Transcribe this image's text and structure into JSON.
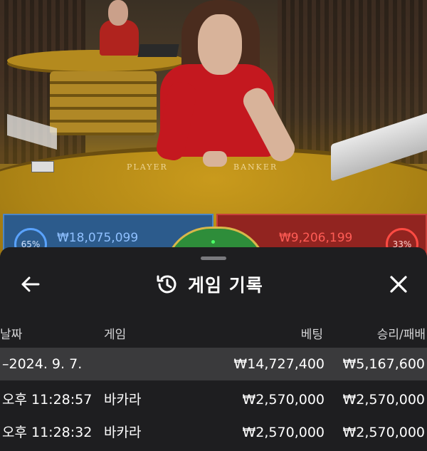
{
  "video": {
    "felt_player": "PLAYER",
    "felt_banker": "BANKER",
    "player_pct": "65%",
    "player_amount": "₩18,075,099",
    "banker_pct": "33%",
    "banker_amount": "₩9,206,199"
  },
  "sheet": {
    "title": "게임 기록",
    "columns": {
      "date": "날짜",
      "game": "게임",
      "bet": "베팅",
      "win_loss": "승리/패배"
    },
    "summary": {
      "date": "–2024. 9. 7.",
      "bet": "₩14,727,400",
      "win_loss": "₩5,167,600"
    },
    "rows": [
      {
        "time": "오후 11:28:57",
        "game": "바카라",
        "bet": "₩2,570,000",
        "win_loss": "₩2,570,000"
      },
      {
        "time": "오후 11:28:32",
        "game": "바카라",
        "bet": "₩2,570,000",
        "win_loss": "₩2,570,000"
      }
    ]
  },
  "colors": {
    "sheet_bg": "#1e1e20",
    "summary_row": "#3a3a3c",
    "player_blue": "#2c5b8c",
    "banker_red": "#922420"
  },
  "icons": {
    "back": "arrow-left-icon",
    "history": "history-icon",
    "close": "close-icon"
  }
}
